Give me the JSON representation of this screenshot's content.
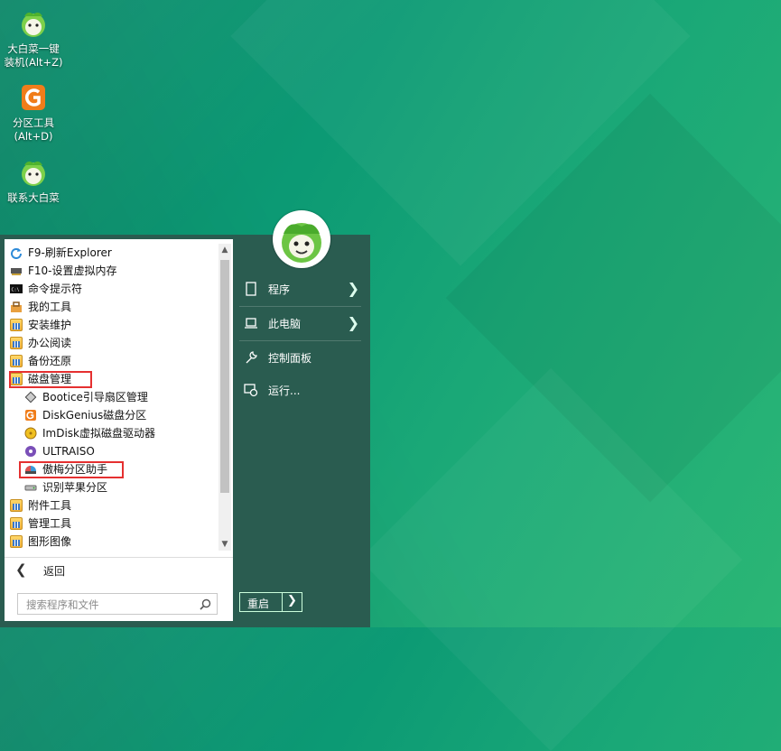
{
  "desktop": {
    "icons": [
      {
        "label_line1": "大白菜一键",
        "label_line2": "装机(Alt+Z)",
        "icon": "cabbage-mascot-icon"
      },
      {
        "label_line1": "分区工具",
        "label_line2": "(Alt+D)",
        "icon": "diskgenius-icon"
      },
      {
        "label_line1": "联系大白菜",
        "label_line2": "",
        "icon": "cabbage-mascot-icon"
      }
    ]
  },
  "start_menu": {
    "programs": [
      {
        "label": "F9-刷新Explorer",
        "icon": "refresh-icon"
      },
      {
        "label": "F10-设置虚拟内存",
        "icon": "memory-icon"
      },
      {
        "label": "命令提示符",
        "icon": "cmd-icon"
      },
      {
        "label": "我的工具",
        "icon": "toolbox-icon"
      },
      {
        "label": "安装维护",
        "icon": "folder-icon"
      },
      {
        "label": "办公阅读",
        "icon": "folder-icon"
      },
      {
        "label": "备份还原",
        "icon": "folder-icon"
      },
      {
        "label": "磁盘管理",
        "icon": "folder-icon"
      },
      {
        "label": "Bootice引导扇区管理",
        "icon": "bootice-icon"
      },
      {
        "label": "DiskGenius磁盘分区",
        "icon": "diskgenius-icon"
      },
      {
        "label": "ImDisk虚拟磁盘驱动器",
        "icon": "imdisk-icon"
      },
      {
        "label": "ULTRAISO",
        "icon": "ultraiso-icon"
      },
      {
        "label": "傲梅分区助手",
        "icon": "aomei-icon"
      },
      {
        "label": "识别苹果分区",
        "icon": "mac-drive-icon"
      },
      {
        "label": "附件工具",
        "icon": "folder-icon"
      },
      {
        "label": "管理工具",
        "icon": "folder-icon"
      },
      {
        "label": "图形图像",
        "icon": "folder-icon"
      }
    ],
    "back_label": "返回",
    "search_placeholder": "搜索程序和文件",
    "right_items": [
      {
        "label": "程序",
        "icon": "document-icon",
        "has_submenu": true
      },
      {
        "label": "此电脑",
        "icon": "laptop-icon",
        "has_submenu": true
      },
      {
        "label": "控制面板",
        "icon": "wrench-icon",
        "has_submenu": false
      },
      {
        "label": "运行...",
        "icon": "run-icon",
        "has_submenu": false
      }
    ],
    "restart_label": "重启",
    "colors": {
      "menu_background": "#2a5c50",
      "highlight_border": "#e53030",
      "desktop_teal": "#0c9a74"
    }
  }
}
